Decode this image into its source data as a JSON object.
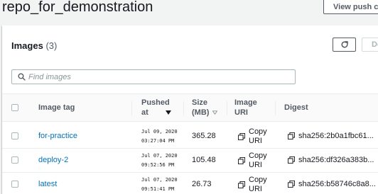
{
  "header": {
    "repo_name": "repo_for_demonstration",
    "view_push_label": "View push commands"
  },
  "images_panel": {
    "title": "Images",
    "count": "(3)",
    "delete_label": "Delete",
    "search_placeholder": "Find images"
  },
  "table": {
    "columns": {
      "image_tag": "Image tag",
      "pushed_line1": "Pushed",
      "pushed_line2": "at",
      "size_line1": "Size",
      "size_line2": "(MB)",
      "uri_line1": "Image",
      "uri_line2": "URI",
      "digest": "Digest"
    },
    "copy_line1": "Copy",
    "copy_line2": "URI",
    "rows": [
      {
        "tag": "for-practice",
        "pushed_date": "Jul 09, 2020",
        "pushed_time": "03:27:04 PM",
        "size": "365.28",
        "digest": "sha256:2b0a1fbc61..."
      },
      {
        "tag": "deploy-2",
        "pushed_date": "Jul 07, 2020",
        "pushed_time": "09:52:56 PM",
        "size": "105.48",
        "digest": "sha256:df326a383b..."
      },
      {
        "tag": "latest",
        "pushed_date": "Jul 07, 2020",
        "pushed_time": "09:51:41 PM",
        "size": "26.73",
        "digest": "sha256:b58746c8a8..."
      }
    ]
  },
  "icons": {
    "refresh": "refresh-icon",
    "search": "search-icon",
    "sort_desc": "sort-descending-icon",
    "sort": "sort-icon",
    "copy": "copy-icon"
  },
  "colors": {
    "link": "#0073bb",
    "page_background": "#f2f3f3",
    "text": "#16191f",
    "muted_text": "#545b64"
  }
}
